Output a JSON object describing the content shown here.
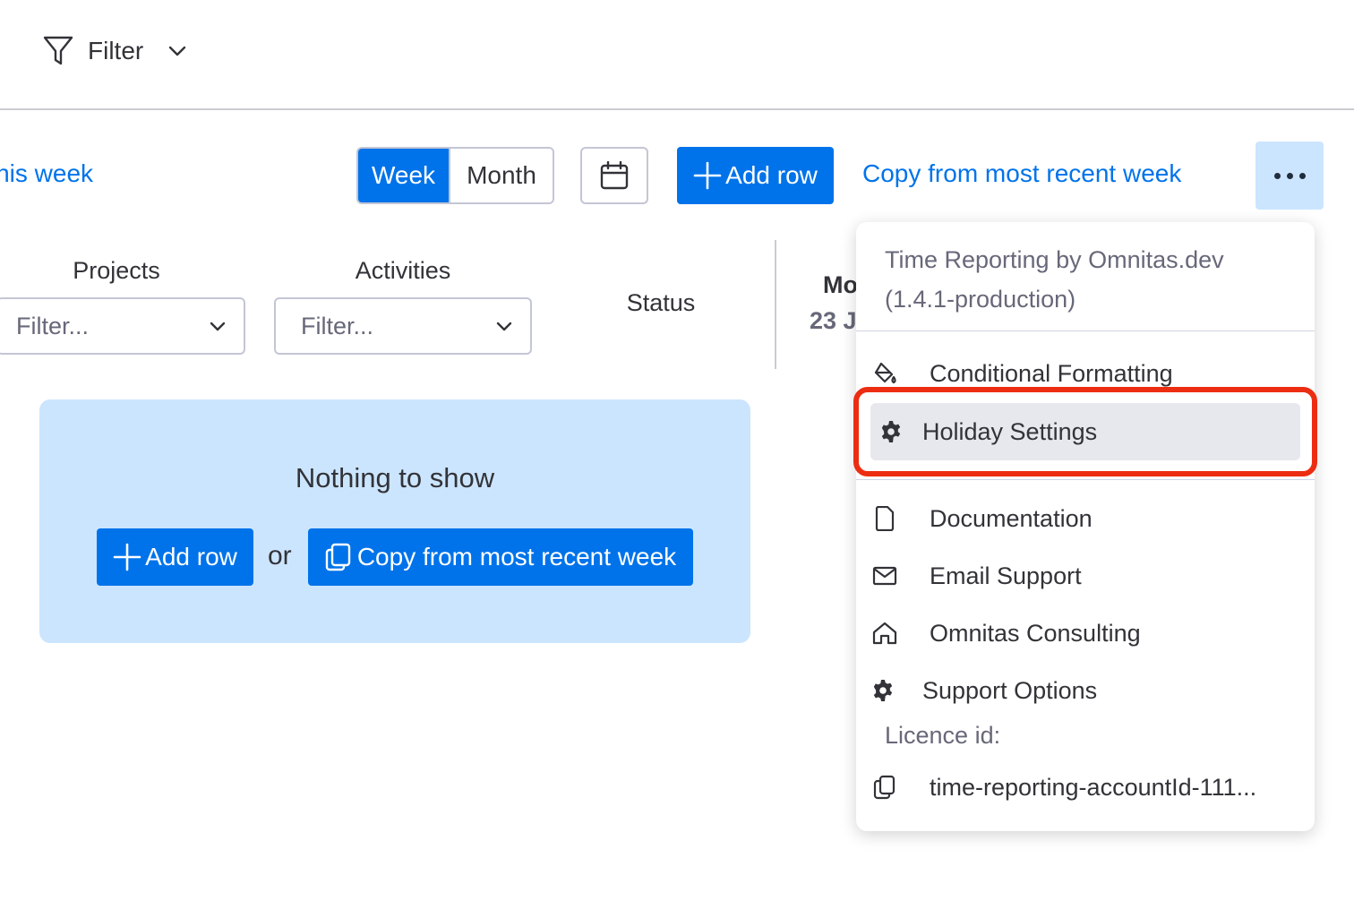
{
  "filter_bar": {
    "label": "Filter"
  },
  "toolbar": {
    "this_week": "This week",
    "view_week": "Week",
    "view_month": "Month",
    "add_row": "Add row",
    "copy_link": "Copy from most recent week"
  },
  "columns": {
    "projects": {
      "title": "Projects",
      "placeholder": "Filter..."
    },
    "activities": {
      "title": "Activities",
      "placeholder": "Filter..."
    },
    "status": "Status",
    "day_abbr": "Mo",
    "day_date": "23 J"
  },
  "empty_state": {
    "title": "Nothing to show",
    "add_row": "Add row",
    "or": "or",
    "copy": "Copy from most recent week"
  },
  "menu": {
    "header_line1": "Time Reporting by Omnitas.dev",
    "header_line2": "(1.4.1-production)",
    "items": [
      {
        "label": "Conditional Formatting",
        "icon": "paint-bucket-icon"
      },
      {
        "label": "Holiday Settings",
        "icon": "gear-icon"
      },
      {
        "label": "Documentation",
        "icon": "document-icon"
      },
      {
        "label": "Email Support",
        "icon": "envelope-icon"
      },
      {
        "label": "Omnitas Consulting",
        "icon": "home-icon"
      },
      {
        "label": "Support Options",
        "icon": "gear-icon"
      }
    ],
    "licence_label": "Licence id:",
    "licence_value": "time-reporting-accountId-111..."
  },
  "colors": {
    "primary": "#0073ea",
    "highlight_light": "#cce5ff",
    "annotation_red": "#ec2d12"
  }
}
